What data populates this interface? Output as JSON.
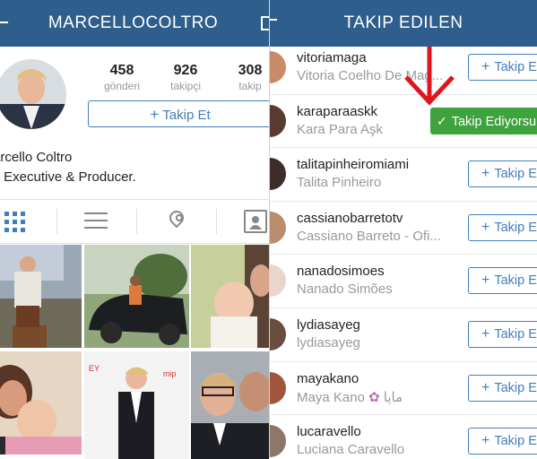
{
  "left": {
    "header_title": "MARCELLOCOLTRO",
    "stats": [
      {
        "value": "458",
        "label": "gönderi"
      },
      {
        "value": "926",
        "label": "takipçi"
      },
      {
        "value": "308",
        "label": "takip"
      }
    ],
    "follow_label": "Takip Et",
    "name": "arcello Coltro",
    "bio": "V Executive & Producer."
  },
  "right": {
    "header_title": "TAKIP EDILEN",
    "follow_label": "Takip E",
    "following_label": "Takip Ediyorsu",
    "users": [
      {
        "username": "vitoriamaga",
        "fullname": "Vitoria Coelho De Mag...",
        "following": false,
        "avatar_color": "#c98a6a"
      },
      {
        "username": "karaparaaskk",
        "fullname": "Kara Para Aşk",
        "following": true,
        "avatar_color": "#5a3b32"
      },
      {
        "username": "talitapinheiromiami",
        "fullname": "Talita Pinheiro",
        "following": false,
        "avatar_color": "#3d2c2a"
      },
      {
        "username": "cassianobarretotv",
        "fullname": "Cassiano Barreto - Ofi...",
        "following": false,
        "avatar_color": "#b98d6e"
      },
      {
        "username": "nanadosimoes",
        "fullname": "Nanado Simões",
        "following": false,
        "avatar_color": "#e8d6cc"
      },
      {
        "username": "lydiasayeg",
        "fullname": "lydiasayeg",
        "following": false,
        "avatar_color": "#6b4d3f"
      },
      {
        "username": "mayakano",
        "fullname": "Maya Kano",
        "fullname_suffix": "مايا",
        "following": false,
        "avatar_color": "#a0563c"
      },
      {
        "username": "lucaravello",
        "fullname": "Luciana Caravello",
        "following": false,
        "avatar_color": "#8f7768"
      }
    ]
  },
  "colors": {
    "header": "#2e5e8c",
    "accent": "#3f7fbf",
    "following_green": "#3ea23e",
    "arrow": "#e0141c"
  }
}
